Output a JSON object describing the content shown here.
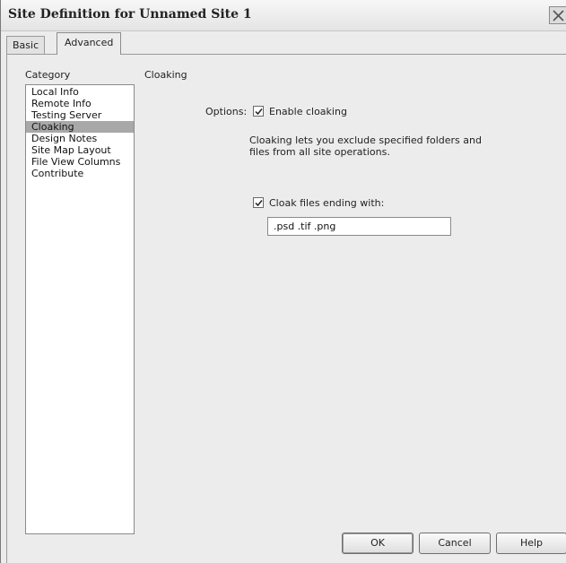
{
  "window": {
    "title": "Site Definition for Unnamed Site 1"
  },
  "tabs": [
    {
      "label": "Basic",
      "active": false
    },
    {
      "label": "Advanced",
      "active": true
    }
  ],
  "category": {
    "header": "Category",
    "items": [
      {
        "label": "Local Info",
        "selected": false
      },
      {
        "label": "Remote Info",
        "selected": false
      },
      {
        "label": "Testing Server",
        "selected": false
      },
      {
        "label": "Cloaking",
        "selected": true
      },
      {
        "label": "Design Notes",
        "selected": false
      },
      {
        "label": "Site Map Layout",
        "selected": false
      },
      {
        "label": "File View Columns",
        "selected": false
      },
      {
        "label": "Contribute",
        "selected": false
      }
    ]
  },
  "section": {
    "title": "Cloaking",
    "options_label": "Options:",
    "enable_cloaking": {
      "label": "Enable cloaking",
      "checked": true
    },
    "description": "Cloaking lets you exclude specified folders and files from all site operations.",
    "cloak_files": {
      "label": "Cloak files ending with:",
      "checked": true
    },
    "extensions_value": ".psd .tif .png"
  },
  "buttons": {
    "ok": "OK",
    "cancel": "Cancel",
    "help": "Help"
  },
  "icons": {
    "close": "close-icon",
    "check": "checkmark-icon"
  }
}
